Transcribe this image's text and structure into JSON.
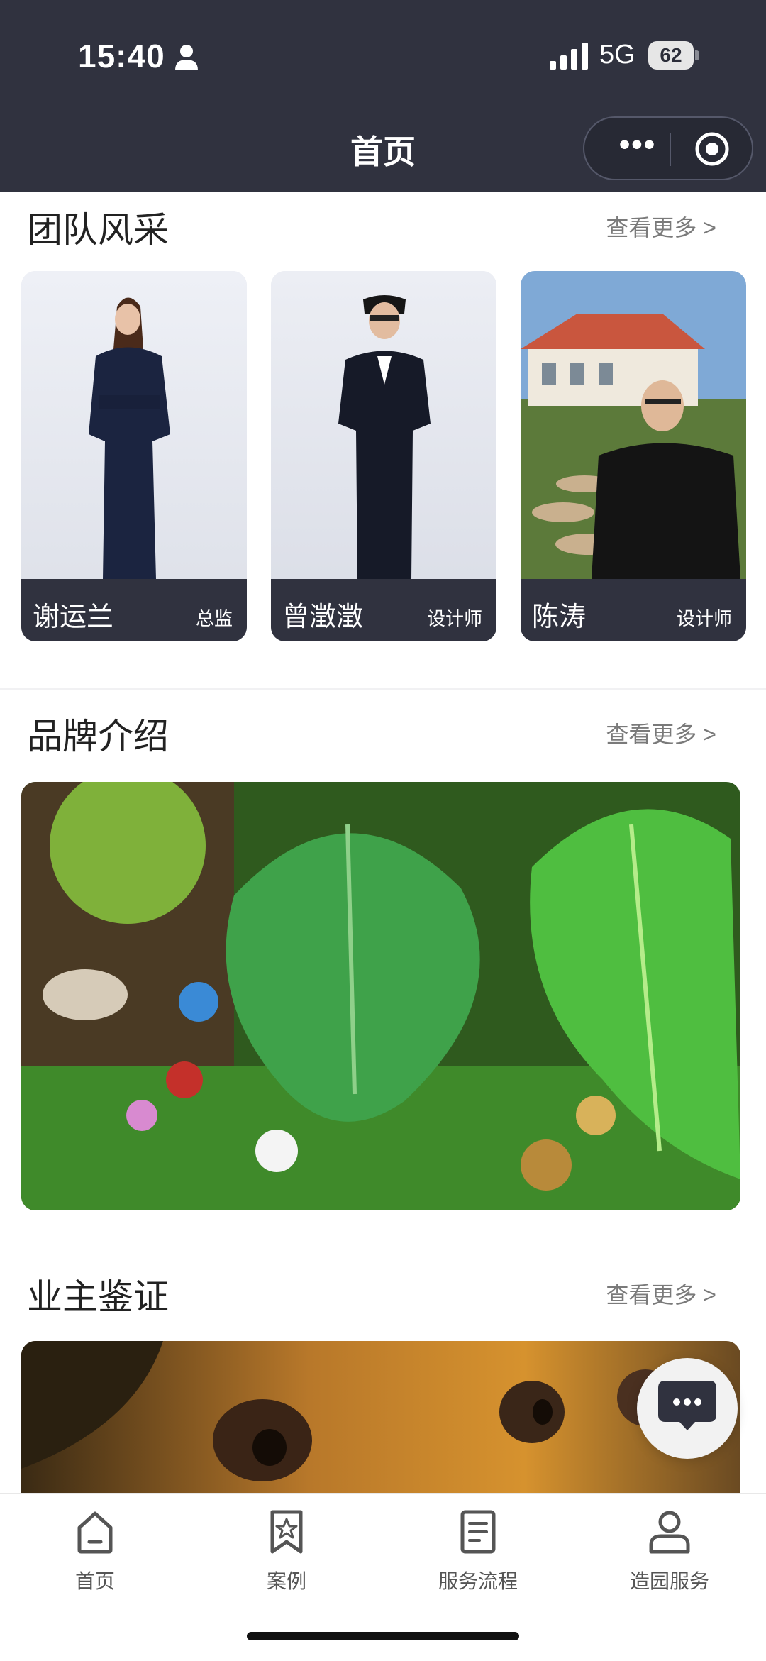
{
  "status_bar": {
    "time": "15:40",
    "network": "5G",
    "battery": "62"
  },
  "header": {
    "title": "首页",
    "more_label": "•••"
  },
  "team": {
    "title": "团队风采",
    "more": "查看更多 >",
    "members": [
      {
        "name": "谢运兰",
        "role": "总监"
      },
      {
        "name": "曾澂澂",
        "role": "设计师"
      },
      {
        "name": "陈涛",
        "role": "设计师"
      }
    ]
  },
  "brand": {
    "title": "品牌介绍",
    "more": "查看更多 >"
  },
  "testimonials": {
    "title": "业主鉴证",
    "more": "查看更多 >"
  },
  "tabbar": {
    "items": [
      {
        "label": "首页",
        "icon": "home-icon"
      },
      {
        "label": "案例",
        "icon": "bookmark-star-icon"
      },
      {
        "label": "服务流程",
        "icon": "document-icon"
      },
      {
        "label": "造园服务",
        "icon": "user-icon"
      }
    ]
  },
  "colors": {
    "header_bg": "#30323f",
    "card_footer_bg": "#30323f",
    "link_gray": "#7a7a7a"
  }
}
